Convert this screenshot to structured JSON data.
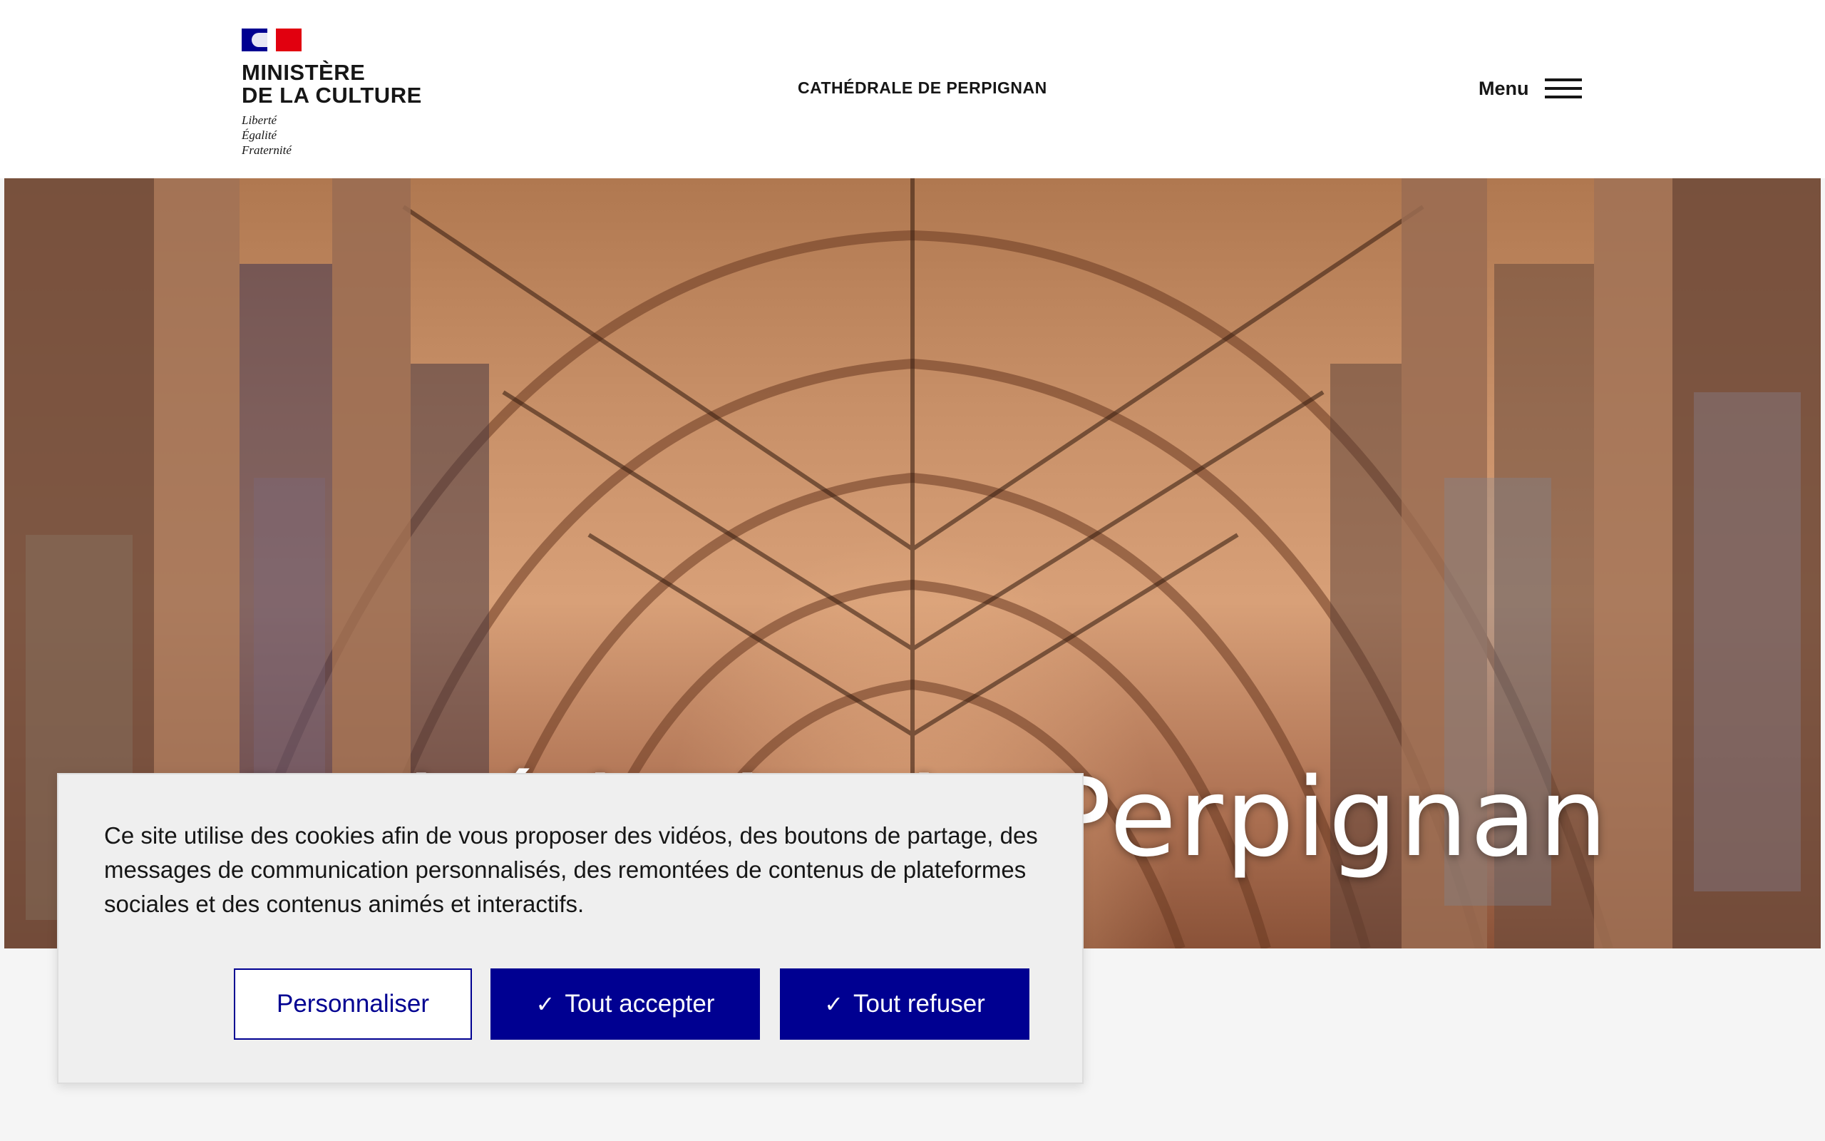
{
  "header": {
    "ministry_line1": "MINISTÈRE",
    "ministry_line2": "DE LA CULTURE",
    "motto_line1": "Liberté",
    "motto_line2": "Égalité",
    "motto_line3": "Fraternité",
    "site_title": "CATHÉDRALE DE PERPIGNAN",
    "menu_label": "Menu"
  },
  "hero": {
    "title": "Cathédrale de Perpignan"
  },
  "cookie_banner": {
    "text": "Ce site utilise des cookies afin de vous proposer des vidéos, des boutons de partage, des messages de communication personnalisés, des remontées de contenus de plateformes sociales et des contenus animés et interactifs.",
    "customize_label": "Personnaliser",
    "accept_label": "Tout accepter",
    "refuse_label": "Tout refuser",
    "check_glyph": "✓"
  },
  "colors": {
    "brand_blue": "#000091",
    "brand_red": "#e1000f",
    "text": "#161616"
  }
}
